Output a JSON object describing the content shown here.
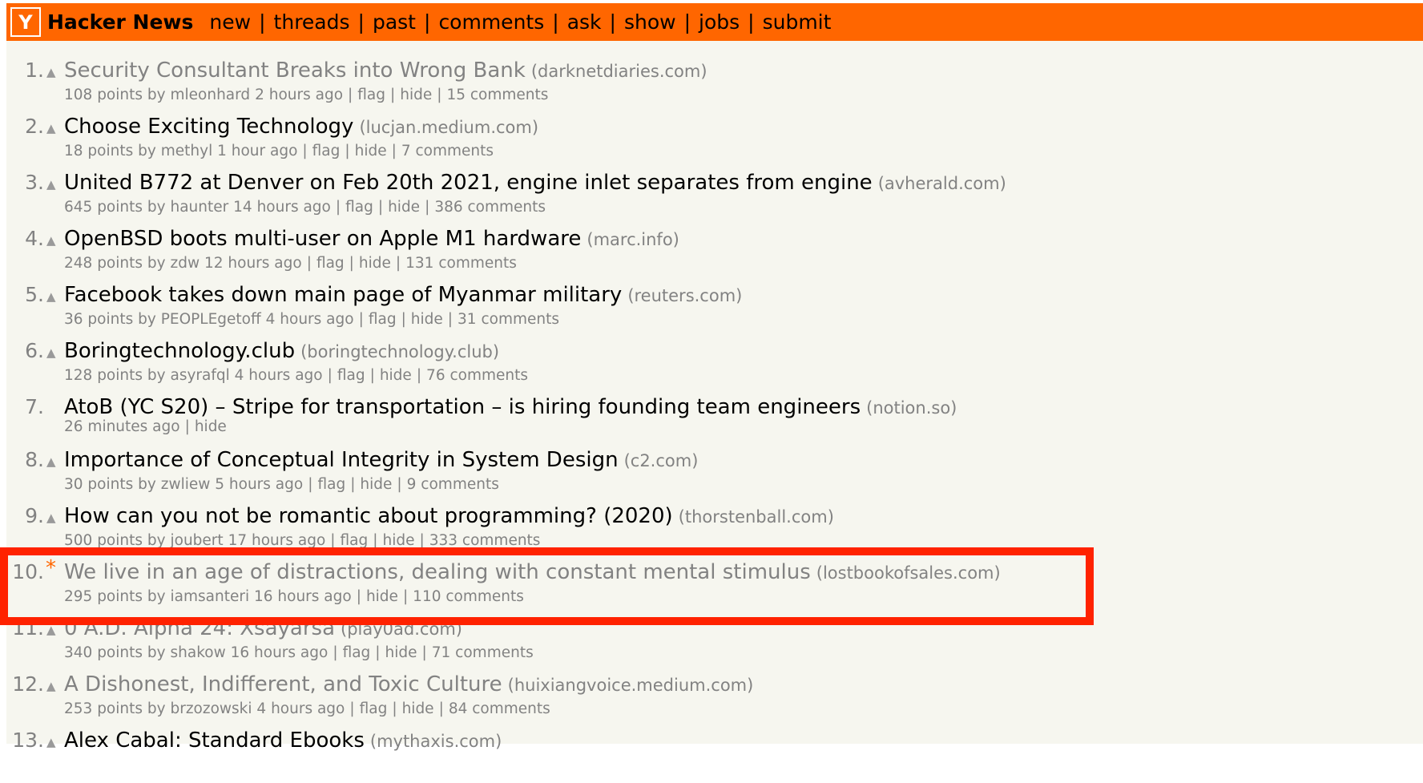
{
  "header": {
    "logo_letter": "Y",
    "brand": "Hacker News",
    "nav": [
      "new",
      "threads",
      "past",
      "comments",
      "ask",
      "show",
      "jobs",
      "submit"
    ],
    "nav_separator": "|",
    "colors": {
      "bar": "#ff6600",
      "background": "#f6f6ef",
      "meta": "#828282",
      "highlight": "#ff2200"
    }
  },
  "icons": {
    "upvote": "▲",
    "new_marker": "*"
  },
  "stories": [
    {
      "rank": "1.",
      "vote": "upvote",
      "title": "Security Consultant Breaks into Wrong Bank",
      "site": "(darknetdiaries.com)",
      "visited": true,
      "points": "108 points",
      "by": "by",
      "user": "mleonhard",
      "age": "2 hours ago",
      "actions": [
        "flag",
        "hide"
      ],
      "comments": "15 comments"
    },
    {
      "rank": "2.",
      "vote": "upvote",
      "title": "Choose Exciting Technology",
      "site": "(lucjan.medium.com)",
      "visited": false,
      "points": "18 points",
      "by": "by",
      "user": "methyl",
      "age": "1 hour ago",
      "actions": [
        "flag",
        "hide"
      ],
      "comments": "7 comments"
    },
    {
      "rank": "3.",
      "vote": "upvote",
      "title": "United B772 at Denver on Feb 20th 2021, engine inlet separates from engine",
      "site": "(avherald.com)",
      "visited": false,
      "points": "645 points",
      "by": "by",
      "user": "haunter",
      "age": "14 hours ago",
      "actions": [
        "flag",
        "hide"
      ],
      "comments": "386 comments"
    },
    {
      "rank": "4.",
      "vote": "upvote",
      "title": "OpenBSD boots multi-user on Apple M1 hardware",
      "site": "(marc.info)",
      "visited": false,
      "points": "248 points",
      "by": "by",
      "user": "zdw",
      "age": "12 hours ago",
      "actions": [
        "flag",
        "hide"
      ],
      "comments": "131 comments"
    },
    {
      "rank": "5.",
      "vote": "upvote",
      "title": "Facebook takes down main page of Myanmar military",
      "site": "(reuters.com)",
      "visited": false,
      "points": "36 points",
      "by": "by",
      "user": "PEOPLEgetoff",
      "age": "4 hours ago",
      "actions": [
        "flag",
        "hide"
      ],
      "comments": "31 comments"
    },
    {
      "rank": "6.",
      "vote": "upvote",
      "title": "Boringtechnology.club",
      "site": "(boringtechnology.club)",
      "visited": false,
      "points": "128 points",
      "by": "by",
      "user": "asyrafql",
      "age": "4 hours ago",
      "actions": [
        "flag",
        "hide"
      ],
      "comments": "76 comments"
    },
    {
      "rank": "7.",
      "vote": "none",
      "job": true,
      "title": "AtoB (YC S20) – Stripe for transportation – is hiring founding team engineers",
      "site": "(notion.so)",
      "visited": false,
      "age": "26 minutes ago",
      "actions": [
        "hide"
      ]
    },
    {
      "rank": "8.",
      "vote": "upvote",
      "title": "Importance of Conceptual Integrity in System Design",
      "site": "(c2.com)",
      "visited": false,
      "points": "30 points",
      "by": "by",
      "user": "zwliew",
      "age": "5 hours ago",
      "actions": [
        "flag",
        "hide"
      ],
      "comments": "9 comments"
    },
    {
      "rank": "9.",
      "vote": "upvote",
      "title": "How can you not be romantic about programming? (2020)",
      "site": "(thorstenball.com)",
      "visited": false,
      "points": "500 points",
      "by": "by",
      "user": "joubert",
      "age": "17 hours ago",
      "actions": [
        "flag",
        "hide"
      ],
      "comments": "333 comments"
    },
    {
      "rank": "10.",
      "vote": "new_marker",
      "title": "We live in an age of distractions, dealing with constant mental stimulus",
      "site": "(lostbookofsales.com)",
      "visited": true,
      "highlighted": true,
      "points": "295 points",
      "by": "by",
      "user": "iamsanteri",
      "age": "16 hours ago",
      "actions": [
        "hide"
      ],
      "comments": "110 comments"
    },
    {
      "rank": "11.",
      "vote": "upvote",
      "title": "0 A.D. Alpha 24: Xšayāršā",
      "site": "(play0ad.com)",
      "visited": true,
      "points": "340 points",
      "by": "by",
      "user": "shakow",
      "age": "16 hours ago",
      "actions": [
        "flag",
        "hide"
      ],
      "comments": "71 comments"
    },
    {
      "rank": "12.",
      "vote": "upvote",
      "title": "A Dishonest, Indifferent, and Toxic Culture",
      "site": "(huixiangvoice.medium.com)",
      "visited": true,
      "points": "253 points",
      "by": "by",
      "user": "brzozowski",
      "age": "4 hours ago",
      "actions": [
        "flag",
        "hide"
      ],
      "comments": "84 comments"
    },
    {
      "rank": "13.",
      "vote": "upvote",
      "title": "Alex Cabal: Standard Ebooks",
      "site": "(mythaxis.com)",
      "visited": false
    }
  ]
}
